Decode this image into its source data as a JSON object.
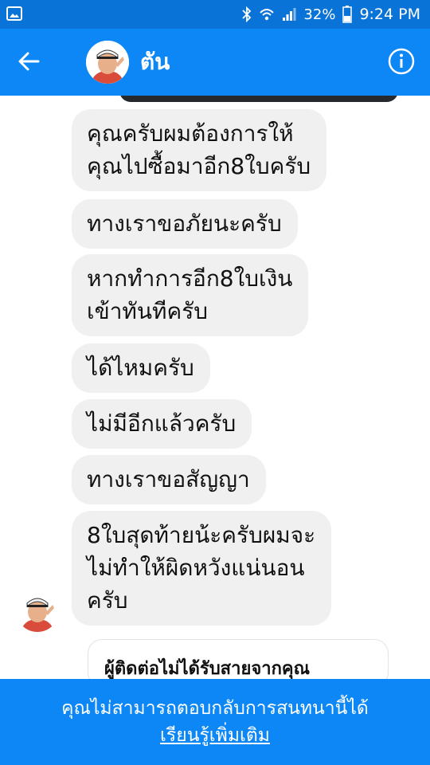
{
  "status_bar": {
    "battery": "32%",
    "time": "9:24 PM",
    "icons": [
      "image-icon",
      "bluetooth-icon",
      "wifi-icon",
      "signal-icon",
      "battery-icon"
    ]
  },
  "header": {
    "contact_name": "ตัน",
    "back_icon": "back-arrow-icon",
    "info_icon": "info-icon"
  },
  "messages": [
    {
      "lines": [
        "คุณครับผมต้องการให้",
        "คุณไปซื้อมาอีก8ใบครับ"
      ]
    },
    {
      "lines": [
        "ทางเราขอภัยนะครับ"
      ]
    },
    {
      "lines": [
        "หากทำการอีก8ใบเงิน",
        "เข้าทันทีครับ"
      ]
    },
    {
      "lines": [
        "ได้ไหมครับ"
      ]
    },
    {
      "lines": [
        "ไม่มีอีกแล้วครับ"
      ]
    },
    {
      "lines": [
        "ทางเราขอสัญญา"
      ]
    },
    {
      "lines": [
        "8ใบสุดท้ายน้ะครับผมจะ",
        "ไม่ทำให้ผิดหวังแน่นอน",
        "ครับ"
      ]
    }
  ],
  "missed_call": {
    "text": "ผู้ติดต่อไม่ได้รับสายจากคุณ"
  },
  "footer": {
    "message": "คุณไม่สามารถตอบกลับการสนทนานี้ได้",
    "link": "เรียนรู้เพิ่มเติม"
  },
  "colors": {
    "status_bar": "#0a73d8",
    "app_bar": "#0c87f5",
    "bubble": "#f1f0f0"
  }
}
